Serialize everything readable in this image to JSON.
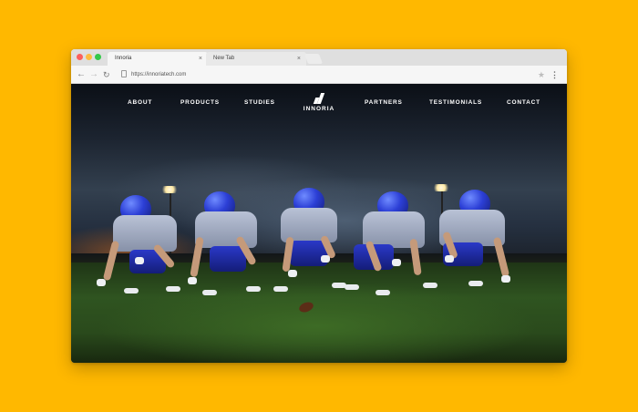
{
  "browser": {
    "tabs": [
      {
        "label": "Innoria",
        "close": "×"
      },
      {
        "label": "New Tab",
        "close": "×"
      }
    ],
    "url": "https://innoriatech.com",
    "icons": {
      "back": "←",
      "forward": "→",
      "reload": "↻",
      "star": "★",
      "menu": "⋮"
    }
  },
  "site": {
    "logo_text": "INNORIA",
    "nav": {
      "about": "ABOUT",
      "products": "PRODUCTS",
      "studies": "STUDIES",
      "partners": "PARTNERS",
      "testimonials": "TESTIMONIALS",
      "contact": "CONTACT"
    }
  },
  "colors": {
    "background": "#FFB800",
    "jersey_blue": "#2c3fd6"
  }
}
